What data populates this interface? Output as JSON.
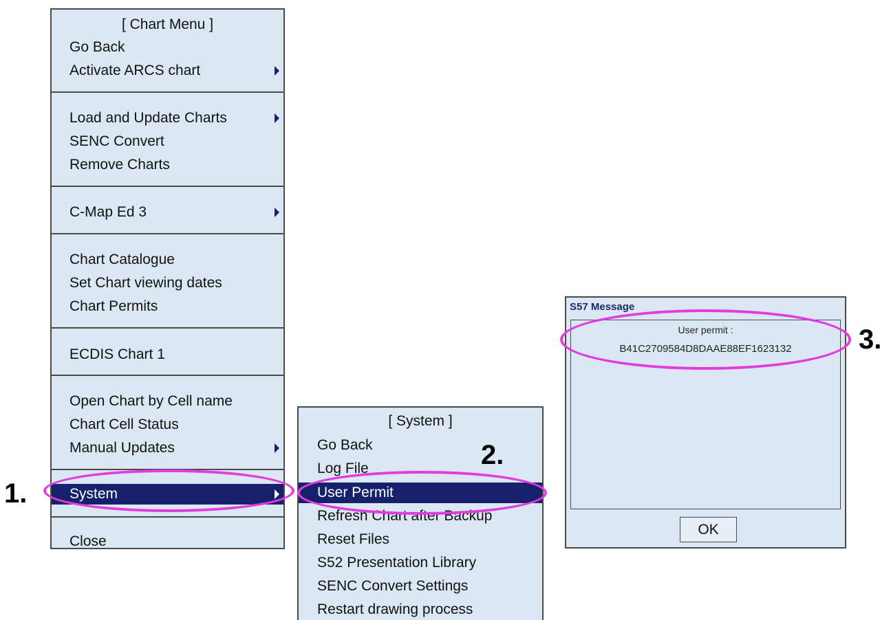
{
  "chart_menu": {
    "title": "[ Chart Menu ]",
    "items": [
      {
        "label": "Go Back",
        "has_submenu": false
      },
      {
        "label": "Activate ARCS chart",
        "has_submenu": true
      },
      {
        "label": "Load and Update Charts",
        "has_submenu": true
      },
      {
        "label": "SENC Convert",
        "has_submenu": false
      },
      {
        "label": "Remove Charts",
        "has_submenu": false
      },
      {
        "label": "C-Map Ed 3",
        "has_submenu": true
      },
      {
        "label": "Chart Catalogue",
        "has_submenu": false
      },
      {
        "label": "Set Chart viewing dates",
        "has_submenu": false
      },
      {
        "label": "Chart Permits",
        "has_submenu": false
      },
      {
        "label": "ECDIS Chart 1",
        "has_submenu": false
      },
      {
        "label": "Open Chart by Cell name",
        "has_submenu": false
      },
      {
        "label": "Chart Cell Status",
        "has_submenu": false
      },
      {
        "label": "Manual Updates",
        "has_submenu": true
      },
      {
        "label": "System",
        "has_submenu": true,
        "selected": true
      },
      {
        "label": "Close",
        "has_submenu": false
      }
    ]
  },
  "system_menu": {
    "title": "[ System ]",
    "items": [
      {
        "label": "Go Back"
      },
      {
        "label": "Log File"
      },
      {
        "label": "User Permit",
        "selected": true
      },
      {
        "label": "Refresh Chart after Backup"
      },
      {
        "label": "Reset Files"
      },
      {
        "label": "S52 Presentation Library"
      },
      {
        "label": "SENC Convert Settings"
      },
      {
        "label": "Restart drawing process"
      }
    ]
  },
  "dialog": {
    "title": "S57 Message",
    "permit_label": "User permit :",
    "permit_value": "B41C2709584D8DAAE88EF1623132",
    "ok_label": "OK"
  },
  "annotations": {
    "step1": "1.",
    "step2": "2.",
    "step3": "3.",
    "highlight_color": "#e23ce0"
  },
  "colors": {
    "panel_bg": "#dbe8f4",
    "selection_bg": "#16206b",
    "dialog_title": "#1b2b6b"
  }
}
